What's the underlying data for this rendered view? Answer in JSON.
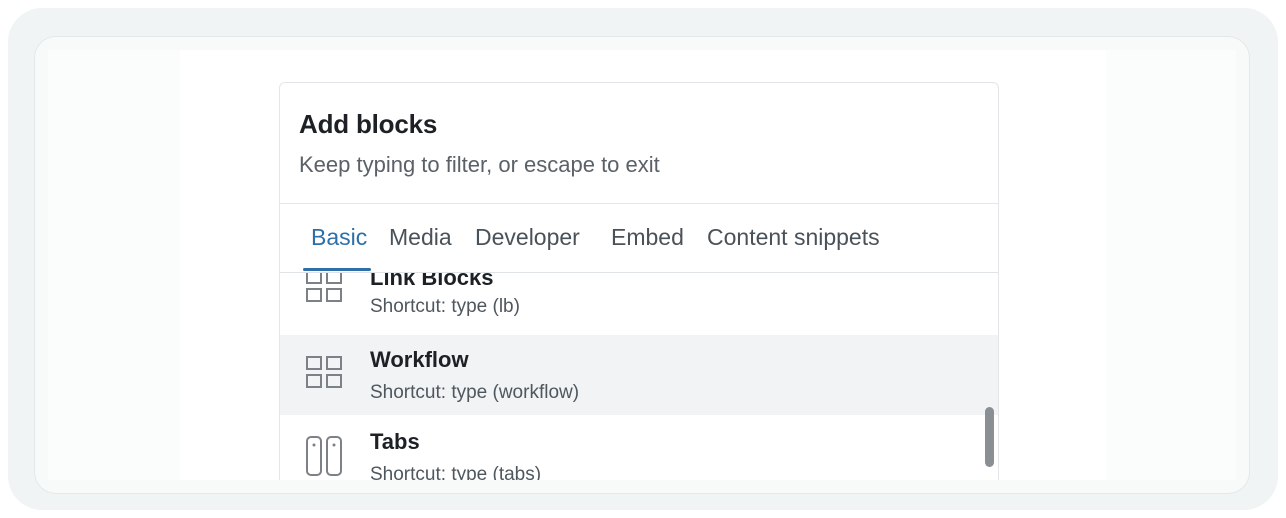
{
  "dialog": {
    "title": "Add blocks",
    "subtitle": "Keep typing to filter, or escape to exit"
  },
  "tabs": [
    {
      "label": "Basic",
      "active": true
    },
    {
      "label": "Media",
      "active": false
    },
    {
      "label": "Developer",
      "active": false
    },
    {
      "label": "Embed",
      "active": false
    },
    {
      "label": "Content snippets",
      "active": false
    }
  ],
  "blocks": [
    {
      "title": "Link Blocks",
      "shortcut": "Shortcut: type (lb)",
      "icon": "grid-icon"
    },
    {
      "title": "Workflow",
      "shortcut": "Shortcut: type (workflow)",
      "icon": "grid-icon",
      "hovered": true
    },
    {
      "title": "Tabs",
      "shortcut": "Shortcut: type (tabs)",
      "icon": "tabs-icon"
    }
  ],
  "colors": {
    "accent": "#2f6fa8",
    "text": "#1d2125",
    "muted": "#5a6168",
    "hover": "#f1f3f5"
  }
}
